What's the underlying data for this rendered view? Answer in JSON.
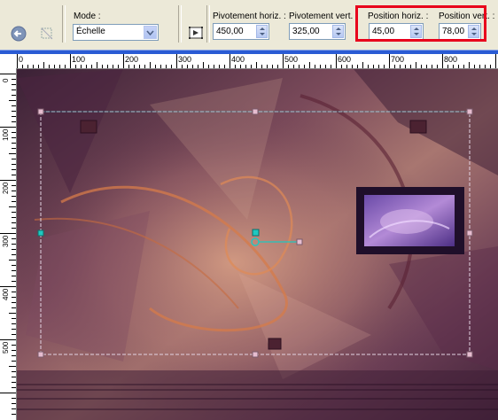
{
  "toolbar": {
    "mode_label": "Mode :",
    "mode_value": "Échelle",
    "pivot_h_label": "Pivotement horiz. :",
    "pivot_h_value": "450,00",
    "pivot_v_label": "Pivotement vert. :",
    "pivot_v_value": "325,00",
    "pos_h_label": "Position horiz. :",
    "pos_h_value": "45,00",
    "pos_v_label": "Position vert. :",
    "pos_v_value": "78,00"
  },
  "ruler": {
    "h_labels": [
      "0",
      "100",
      "200",
      "300",
      "400",
      "500",
      "600",
      "700",
      "800"
    ],
    "v_labels": [
      "0",
      "100",
      "200",
      "300",
      "400",
      "500"
    ]
  },
  "colors": {
    "highlight": "#e8001c",
    "selection_line": "#d8c8d8",
    "handle": "#e6bdd0",
    "pivot_handle": "#1fc8c0"
  },
  "icons": [
    "back-arrow-icon",
    "deform-tool-icon",
    "apply-transform-icon"
  ]
}
